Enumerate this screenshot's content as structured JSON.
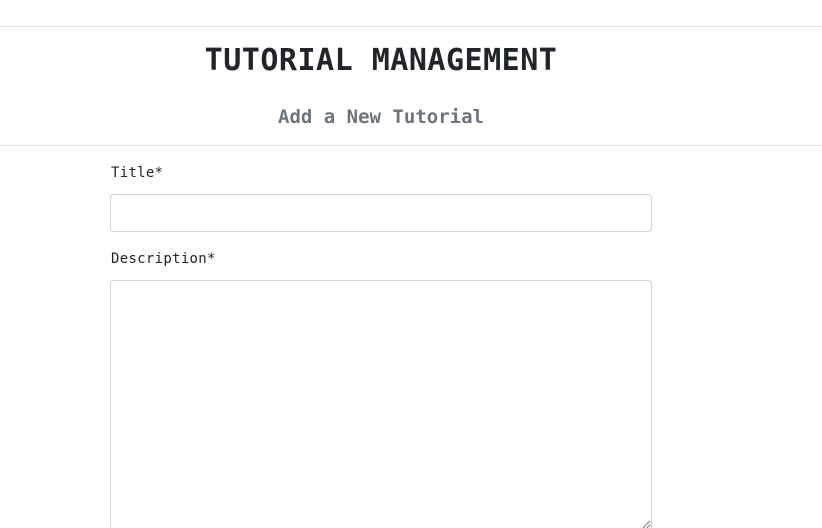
{
  "header": {
    "title": "TUTORIAL MANAGEMENT",
    "subtitle": "Add a New Tutorial"
  },
  "form": {
    "title_field": {
      "label": "Title*",
      "value": "",
      "placeholder": ""
    },
    "description_field": {
      "label": "Description*",
      "value": "",
      "placeholder": ""
    }
  },
  "colors": {
    "text": "#212529",
    "muted": "#6c757d",
    "border": "#ced4da",
    "divider": "#e3e3e3"
  }
}
